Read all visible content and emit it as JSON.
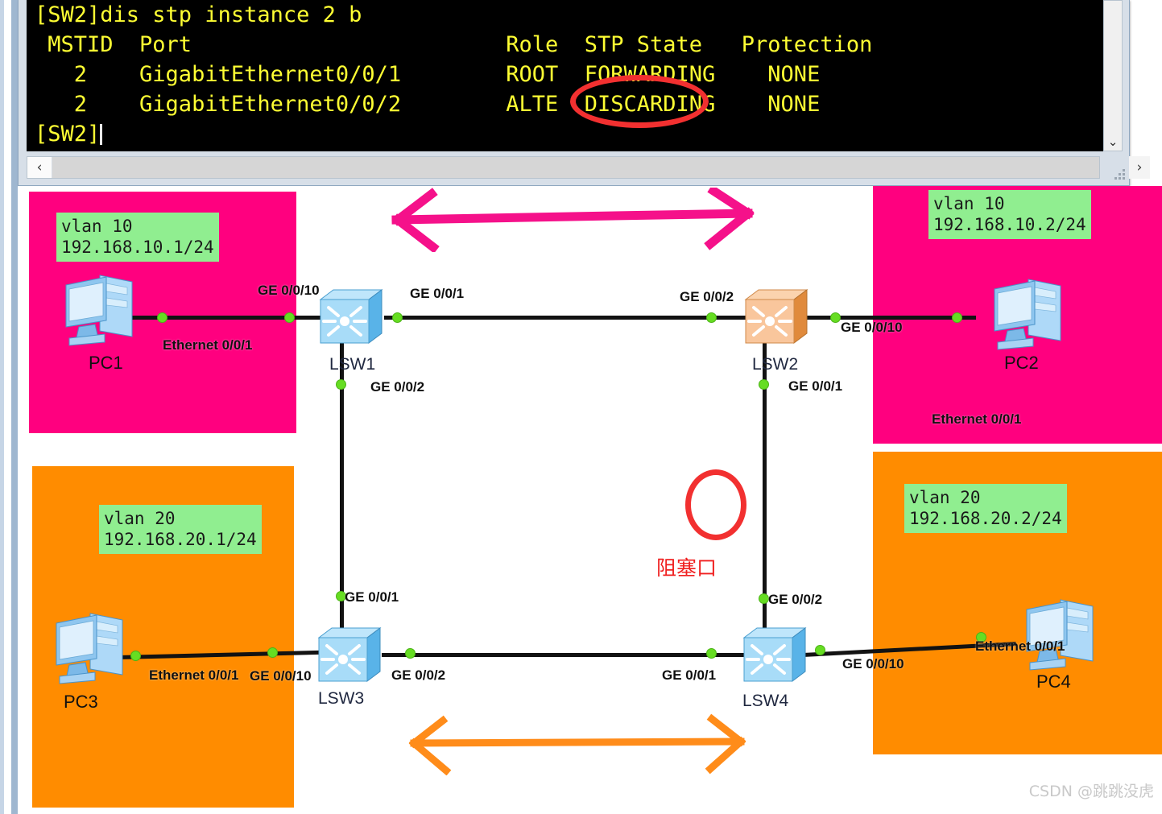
{
  "terminal": {
    "lines": [
      "[SW2]dis stp instance 2 b",
      " MSTID  Port                        Role  STP State   Protection",
      "   2    GigabitEthernet0/0/1        ROOT  FORWARDING    NONE",
      "   2    GigabitEthernet0/0/2        ALTE  DISCARDING    NONE",
      "[SW2]"
    ],
    "command": "[SW2]dis stp instance 2 b",
    "columns": [
      "MSTID",
      "Port",
      "Role",
      "STP State",
      "Protection"
    ],
    "rows": [
      {
        "mstid": "2",
        "port": "GigabitEthernet0/0/1",
        "role": "ROOT",
        "stp_state": "FORWARDING",
        "protection": "NONE"
      },
      {
        "mstid": "2",
        "port": "GigabitEthernet0/0/2",
        "role": "ALTE",
        "stp_state": "DISCARDING",
        "protection": "NONE"
      }
    ],
    "prompt": "[SW2]",
    "scroll_left_arrow": "‹",
    "scroll_right_arrow": "›",
    "scroll_down_arrow": "⌄",
    "text_color": "#ffff33",
    "background_color": "#000000",
    "highlight_circle_target": "ALTE"
  },
  "diagram": {
    "zones": [
      {
        "name": "vlan10-left",
        "color": "#ff007f",
        "label": "vlan 10\n192.168.10.1/24"
      },
      {
        "name": "vlan10-right",
        "color": "#ff007f",
        "label": "vlan 10\n192.168.10.2/24"
      },
      {
        "name": "vlan20-left",
        "color": "#ff8c00",
        "label": "vlan 20\n192.168.20.1/24"
      },
      {
        "name": "vlan20-right",
        "color": "#ff8c00",
        "label": "vlan 20\n192.168.20.2/24"
      }
    ],
    "vlan_labels": {
      "top_left": "vlan 10\n192.168.10.1/24",
      "top_right": "vlan 10\n192.168.10.2/24",
      "bottom_left": "vlan 20\n192.168.20.1/24",
      "bottom_right": "vlan 20\n192.168.20.2/24"
    },
    "devices": {
      "pc1": "PC1",
      "pc2": "PC2",
      "pc3": "PC3",
      "pc4": "PC4",
      "lsw1": "LSW1",
      "lsw2": "LSW2",
      "lsw3": "LSW3",
      "lsw4": "LSW4"
    },
    "port_labels": {
      "pc1_eth": "Ethernet 0/0/1",
      "lsw1_ge10": "GE 0/0/10",
      "lsw1_ge1": "GE 0/0/1",
      "lsw1_ge2": "GE 0/0/2",
      "lsw2_ge2": "GE 0/0/2",
      "lsw2_ge10": "GE 0/0/10",
      "lsw2_ge1": "GE 0/0/1",
      "pc2_eth": "Ethernet 0/0/1",
      "pc3_eth": "Ethernet 0/0/1",
      "lsw3_ge10": "GE 0/0/10",
      "lsw3_ge1": "GE 0/0/1",
      "lsw3_ge2": "GE 0/0/2",
      "lsw4_ge1": "GE 0/0/1",
      "lsw4_ge2": "GE 0/0/2",
      "lsw4_ge10": "GE 0/0/10",
      "pc4_eth": "Ethernet 0/0/1"
    },
    "annotations": {
      "blocked_port": "阻塞口",
      "blocked_port_color": "#f02020",
      "top_arrow_color": "#f5118a",
      "bottom_arrow_color": "#ff8c1a",
      "circle_color": "#f23030"
    }
  },
  "watermark": "CSDN @跳跳没虎"
}
